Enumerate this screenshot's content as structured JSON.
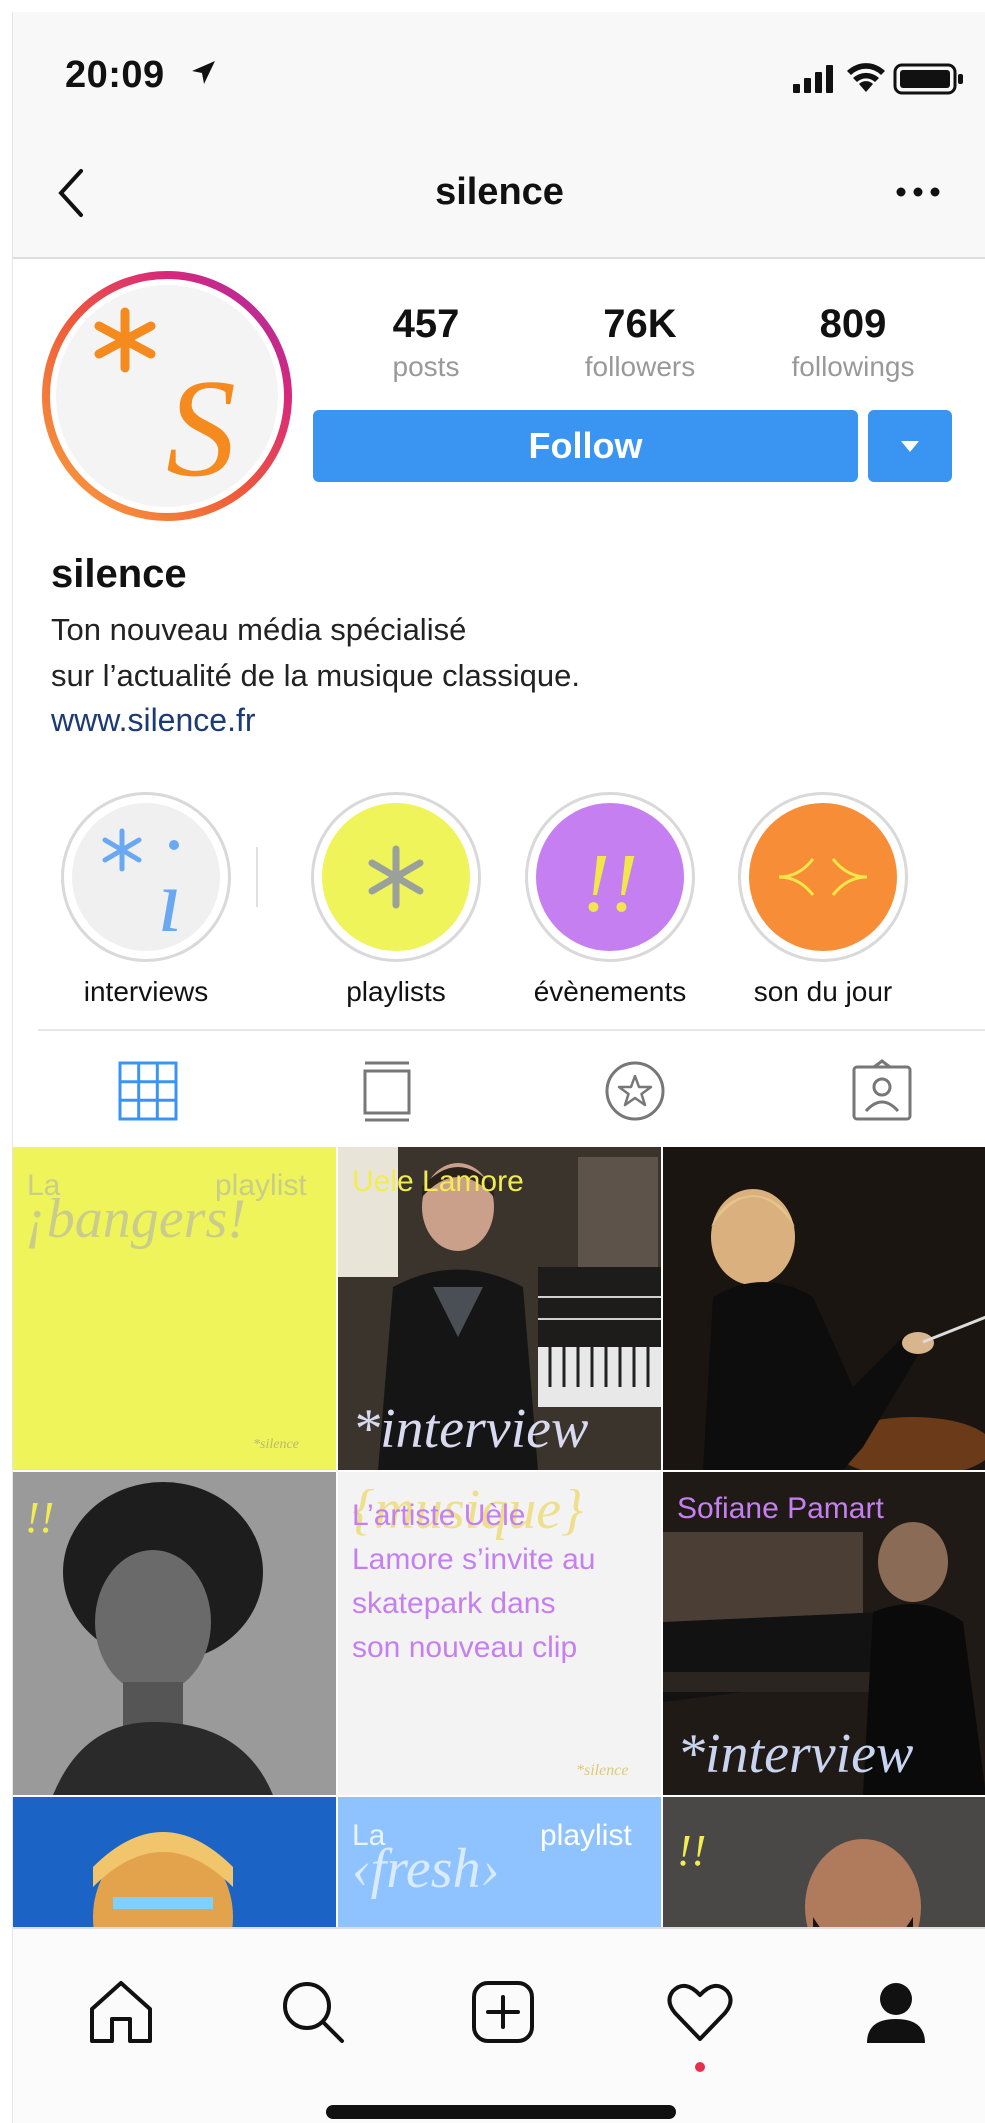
{
  "status_bar": {
    "time": "20:09"
  },
  "nav": {
    "title": "silence"
  },
  "profile": {
    "stats": [
      {
        "value": "457",
        "label": "posts"
      },
      {
        "value": "76K",
        "label": "followers"
      },
      {
        "value": "809",
        "label": "followings"
      }
    ],
    "follow_label": "Follow",
    "username": "silence",
    "bio_line1": "Ton nouveau média spécialisé",
    "bio_line2": "sur l’actualité de la musique classique.",
    "website": "www.silence.fr"
  },
  "highlights": [
    {
      "label": "interviews",
      "color": "#f0f0f0"
    },
    {
      "label": "playlists",
      "color": "#eef45a"
    },
    {
      "label": "évènements",
      "color": "#c67ff0"
    },
    {
      "label": "son du jour",
      "color": "#f78d36"
    }
  ],
  "tabs": [
    "grid-icon",
    "feed-icon",
    "star-icon",
    "tagged-icon"
  ],
  "grid": {
    "p1": {
      "small_left": "La",
      "small_right": "playlist",
      "script": "¡bangers!",
      "brand": "*silence"
    },
    "p2": {
      "caption": "Uele Lamore",
      "script": "*interview"
    },
    "p4": {
      "mark": "!!"
    },
    "p5": {
      "script": "{musique}",
      "text_line1": "L’artiste Uèle",
      "text_line2": "Lamore s’invite au",
      "text_line3": "skatepark dans",
      "text_line4": "son nouveau clip",
      "brand": "*silence"
    },
    "p6": {
      "caption": "Sofiane Pamart",
      "script": "*interview"
    },
    "p8": {
      "small_left": "La",
      "small_right": "playlist",
      "script": "‹fresh›"
    },
    "p9": {
      "mark": "!!"
    }
  },
  "bottom_nav": [
    "home-icon",
    "search-icon",
    "add-post-icon",
    "activity-heart-icon",
    "profile-icon"
  ],
  "colors": {
    "accent": "#3a95f2",
    "link": "#1d3b73",
    "notification": "#e8304a"
  }
}
